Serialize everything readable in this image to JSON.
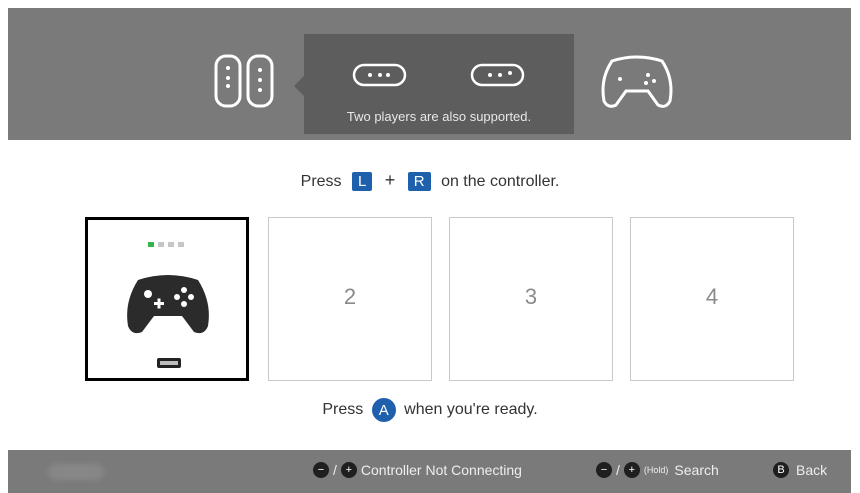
{
  "header": {
    "hint_text": "Two players are also supported."
  },
  "instructions": {
    "press_prefix": "Press",
    "key_l": "L",
    "plus": "+",
    "key_r": "R",
    "press_suffix": "on the controller."
  },
  "slots": [
    {
      "label": ""
    },
    {
      "label": "2"
    },
    {
      "label": "3"
    },
    {
      "label": "4"
    }
  ],
  "ready": {
    "prefix": "Press",
    "button": "A",
    "suffix": "when you're ready."
  },
  "footer": {
    "hint1_sep": "/",
    "hint1_label": "Controller Not Connecting",
    "hint2_sep": "/",
    "hint2_hold": "(Hold)",
    "hint2_label": "Search",
    "back_button": "B",
    "back_label": "Back"
  },
  "colors": {
    "accent_blue": "#1f60ad",
    "led_green": "#33b54a",
    "header_gray": "#7a7a7a"
  }
}
